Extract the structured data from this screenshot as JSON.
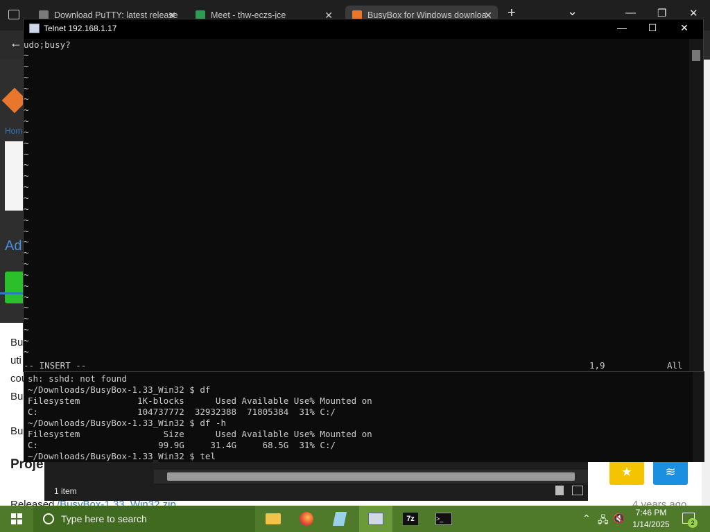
{
  "browser": {
    "tabs": [
      {
        "title": "Download PuTTY: latest release"
      },
      {
        "title": "Meet - thw-eczs-jce"
      },
      {
        "title": "BusyBox for Windows downloa"
      }
    ],
    "new_tab": "+",
    "tab_list": "⌄",
    "minimize": "—",
    "restore": "❐",
    "close": "✕"
  },
  "webpage": {
    "nav_home": "Hom",
    "side_text": [
      "Ad",
      "Bu",
      "uti",
      "cou",
      "Bus",
      "Bus",
      "Proje"
    ],
    "released_prefix": "Released ",
    "released_link": "/BusyBox-1.33_Win32.zip",
    "released_age": "4 years ago"
  },
  "explorer": {
    "status": "1 item"
  },
  "terminal_back": {
    "lines": [
      "sh: sshd: not found",
      "~/Downloads/BusyBox-1.33_Win32 $ df",
      "Filesystem           1K-blocks      Used Available Use% Mounted on",
      "C:                   104737772  32932388  71805384  31% C:/",
      "~/Downloads/BusyBox-1.33_Win32 $ df -h",
      "Filesystem                Size      Used Available Use% Mounted on",
      "C:                       99.9G     31.4G     68.5G  31% C:/",
      "~/Downloads/BusyBox-1.33_Win32 $ tel"
    ]
  },
  "telnet": {
    "title": "Telnet 192.168.1.17",
    "first_line": "udo;busy?",
    "tilde": "~",
    "mode": "-- INSERT --",
    "cursor_pos": "1,9",
    "scroll_pos": "All",
    "minimize": "—",
    "maximize": "☐",
    "close": "✕"
  },
  "taskbar": {
    "search_placeholder": "Type here to search",
    "time": "7:46 PM",
    "date": "1/14/2025",
    "notifications": "2"
  }
}
